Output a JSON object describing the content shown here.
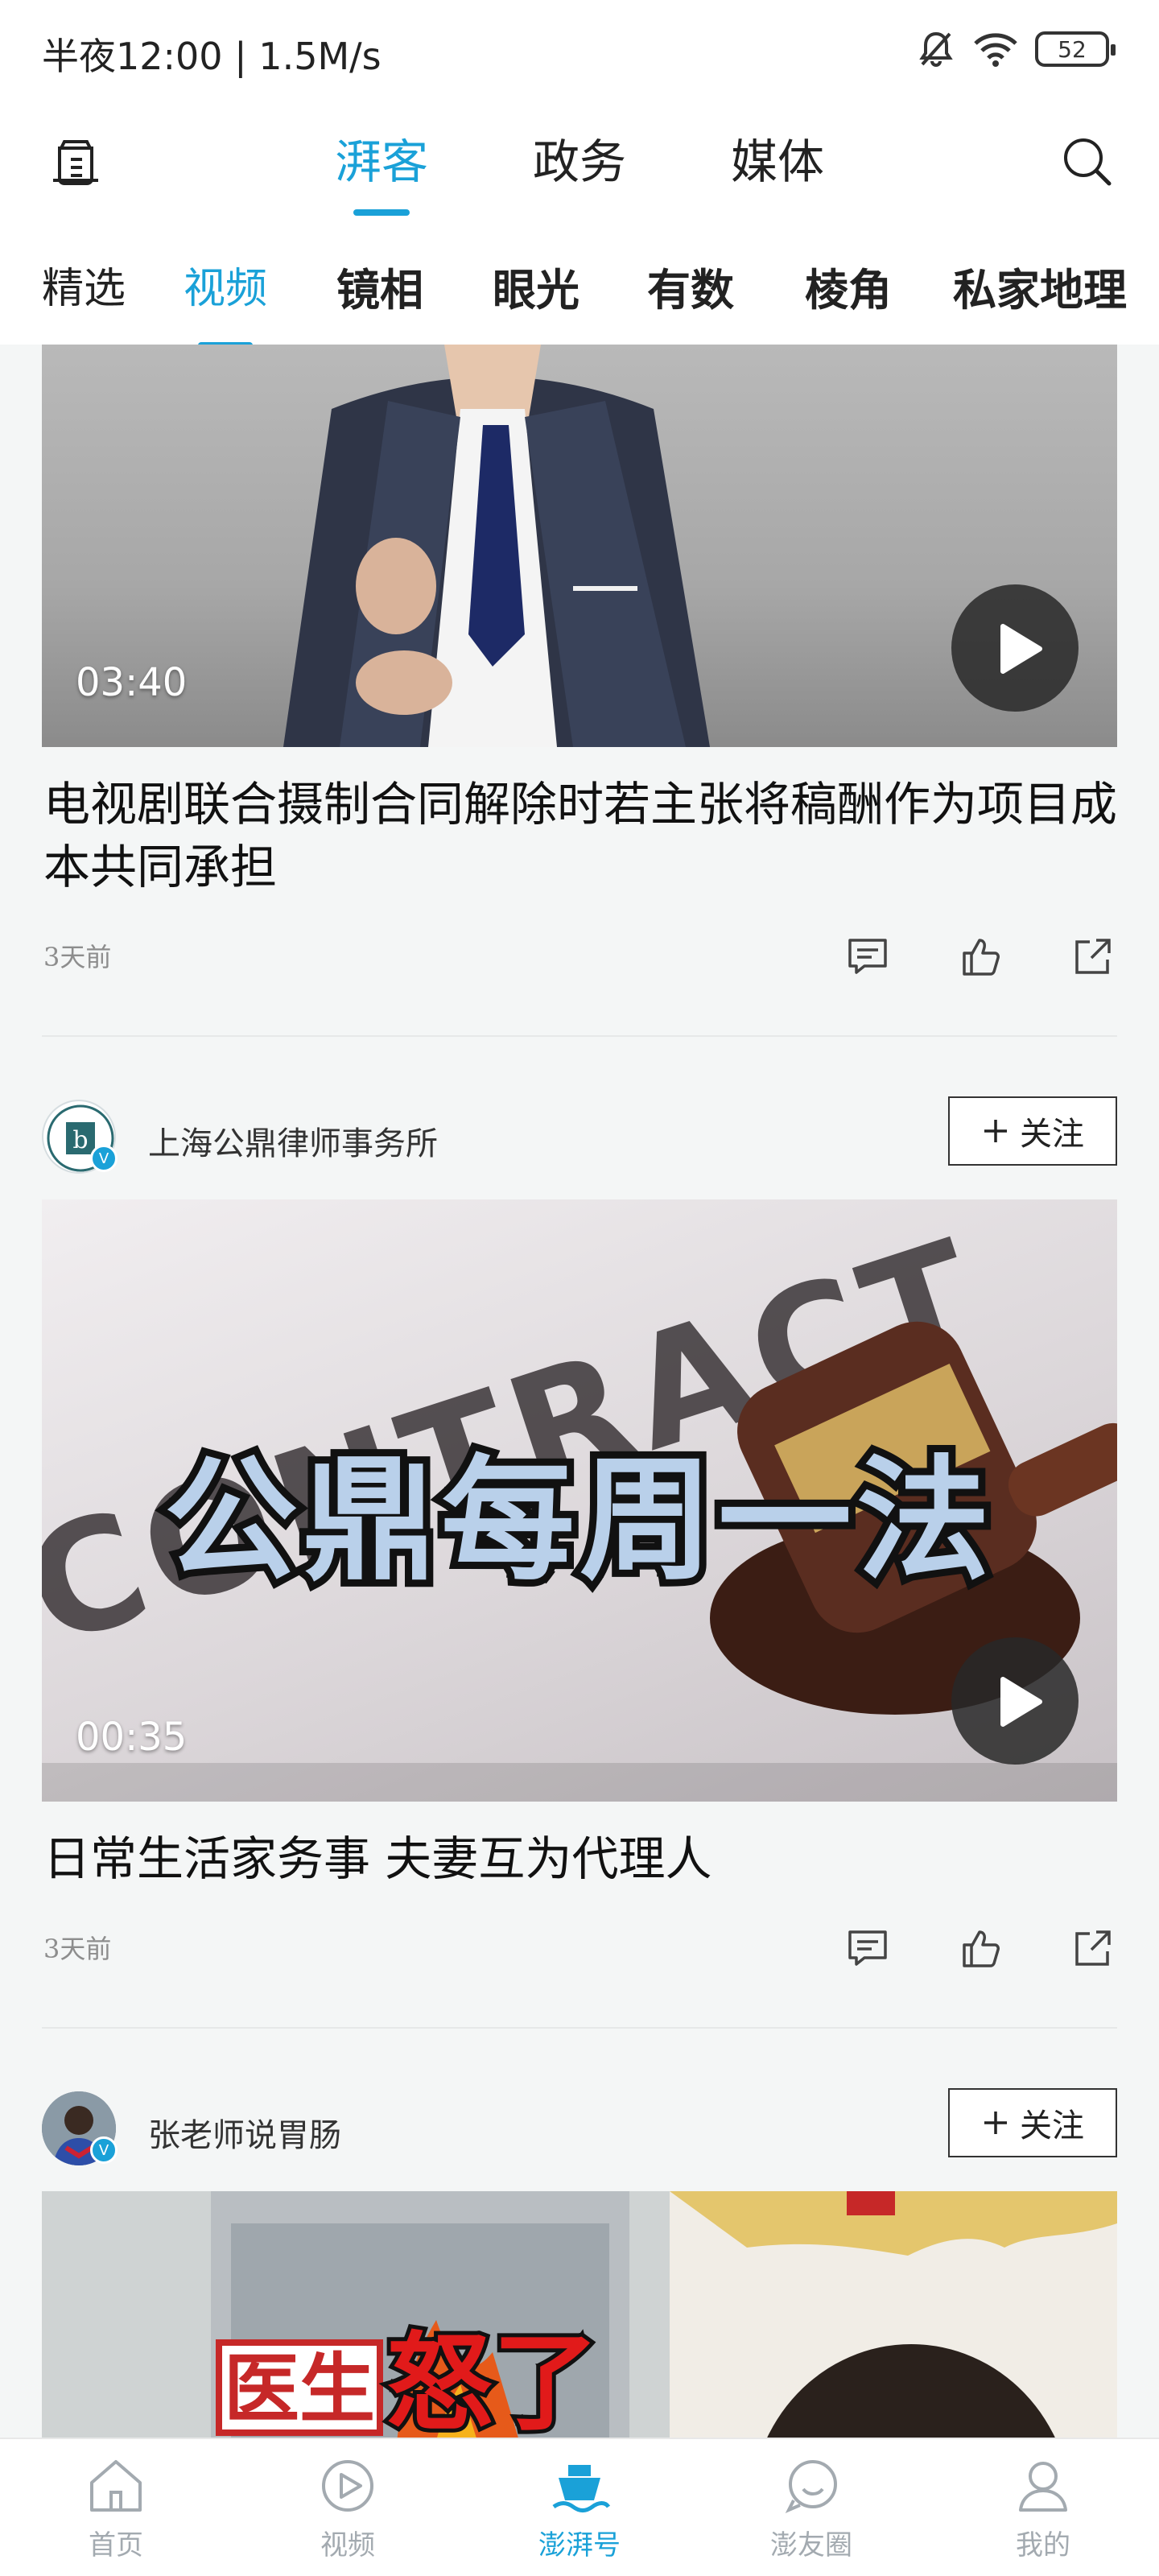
{
  "status_bar": {
    "time": "半夜12:00 | 1.5M/s",
    "battery": "52"
  },
  "header": {
    "tabs": [
      {
        "label": "湃客"
      },
      {
        "label": "政务"
      },
      {
        "label": "媒体"
      }
    ]
  },
  "channels": [
    {
      "label": "精选"
    },
    {
      "label": "视频"
    },
    {
      "label": "镜相"
    },
    {
      "label": "眼光"
    },
    {
      "label": "有数"
    },
    {
      "label": "棱角"
    },
    {
      "label": "私家地理"
    }
  ],
  "feed": {
    "items": [
      {
        "duration": "03:40",
        "title": "电视剧联合摄制合同解除时若主张将稿酬作为项目成本共同承担",
        "time": "3天前"
      },
      {
        "author": "上海公鼎律师事务所",
        "follow": "关注",
        "thumb_text": "公鼎每周一法",
        "thumb_bg_text": "CONTRACT",
        "duration": "00:35",
        "title": "日常生活家务事  夫妻互为代理人",
        "time": "3天前"
      },
      {
        "author": "张老师说胃肠",
        "follow": "关注",
        "thumb_text_red_box": "医生",
        "thumb_text_red": "怒了"
      }
    ]
  },
  "bottom_nav": [
    {
      "label": "首页"
    },
    {
      "label": "视频"
    },
    {
      "label": "澎湃号"
    },
    {
      "label": "澎友圈"
    },
    {
      "label": "我的"
    }
  ],
  "colors": {
    "accent": "#1aa1d8"
  }
}
